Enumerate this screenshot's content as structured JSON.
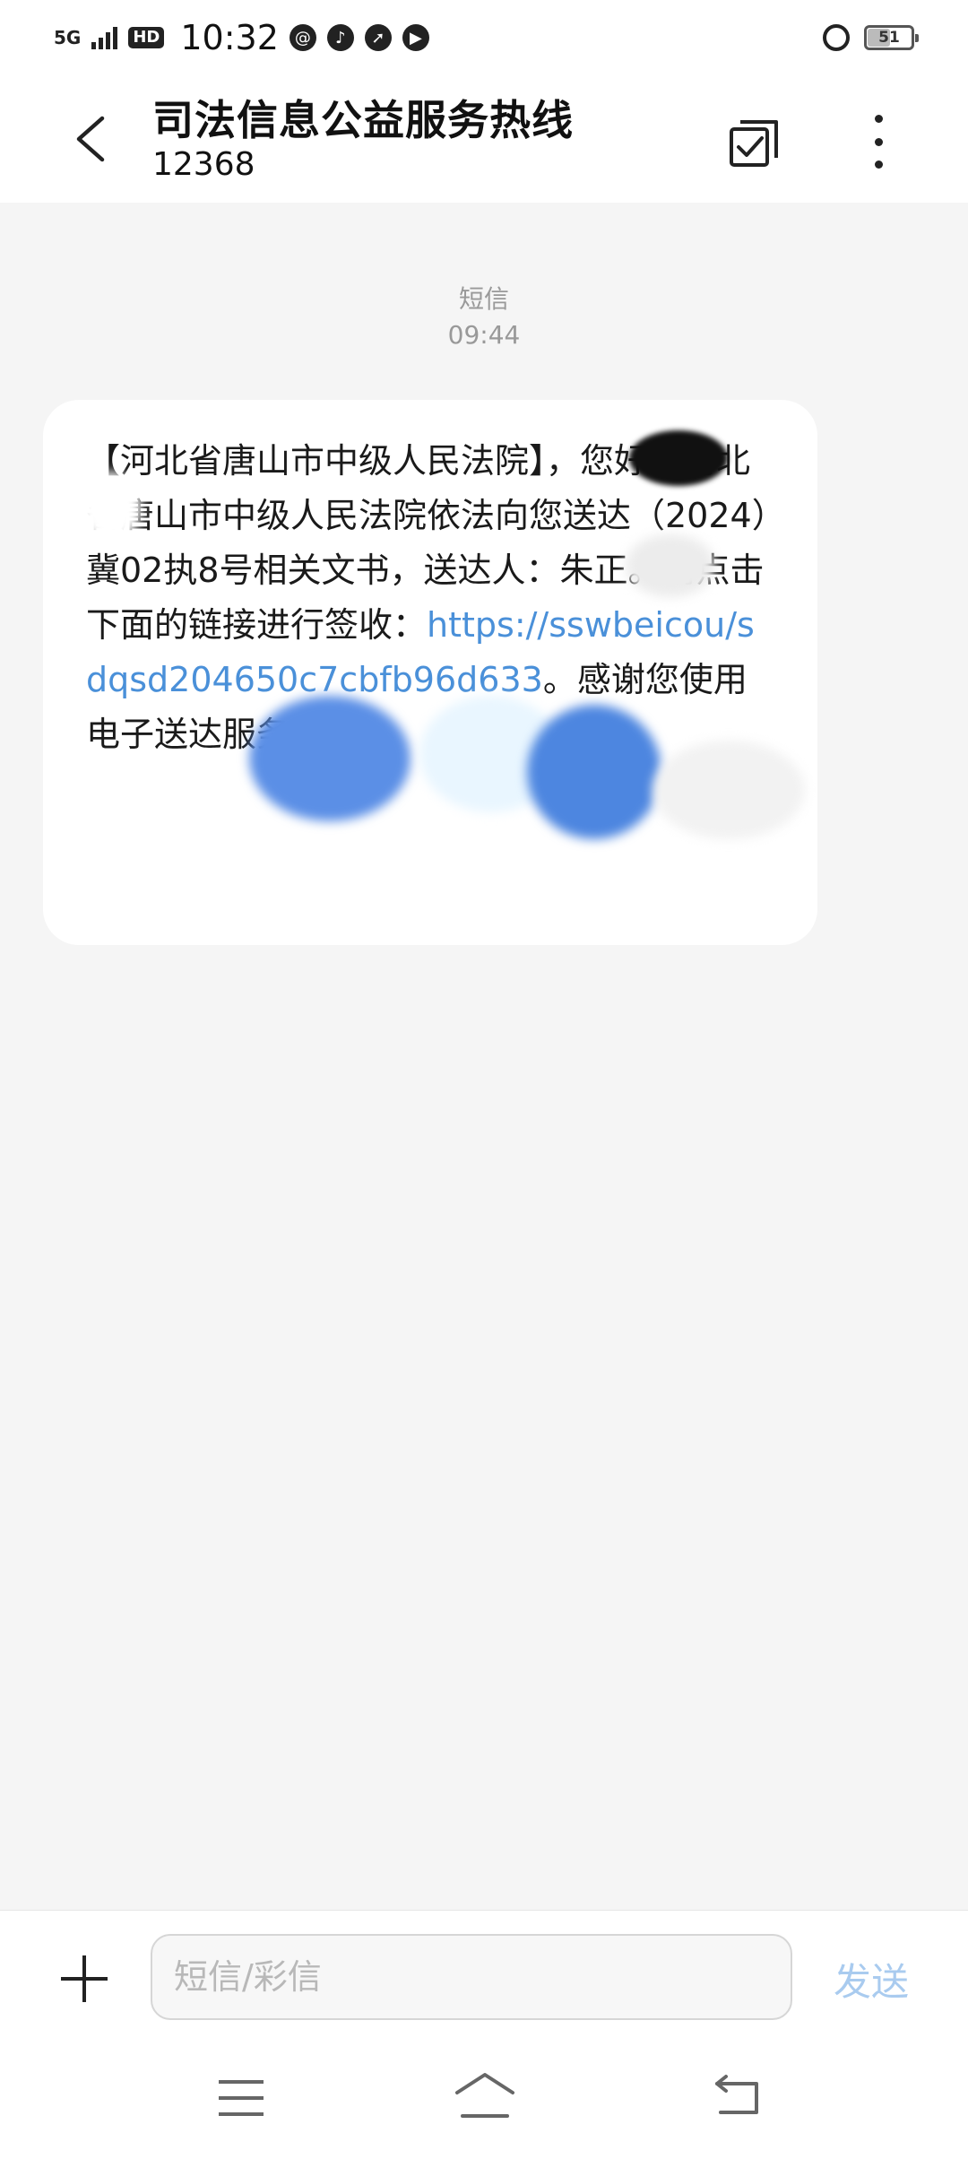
{
  "status": {
    "network": "5G",
    "hd": "HD",
    "time": "10:32",
    "icons": [
      "at-icon",
      "tiktok-icon",
      "compass-icon",
      "play-icon"
    ],
    "battery": "51"
  },
  "header": {
    "title": "司法信息公益服务热线",
    "subtitle": "12368"
  },
  "message": {
    "type_label": "短信",
    "time": "09:44",
    "segments": [
      {
        "text": "【河北省唐山市中级人民法院】",
        "link": false
      },
      {
        "text": "，您好：河北省唐山市中级人民法院依法向您送达（2024）冀02执8",
        "link": false
      },
      {
        "text": "号相关文书，送达人：朱正。请点击下面的链接进行签收：",
        "link": false
      },
      {
        "text": "https://ssw",
        "link": true
      },
      {
        "text": "beicou",
        "link": true
      },
      {
        "text": "/sdqs",
        "link": true
      },
      {
        "text": "d204650c7cbfb96d6",
        "link": true
      },
      {
        "text": "33",
        "link": true
      },
      {
        "text": "。感谢您使用电子送达服务！",
        "link": false
      }
    ]
  },
  "input": {
    "placeholder": "短信/彩信",
    "send_label": "发送"
  },
  "colors": {
    "link": "#4a90d9",
    "send_disabled": "#a9cbef",
    "background": "#f5f5f5"
  }
}
